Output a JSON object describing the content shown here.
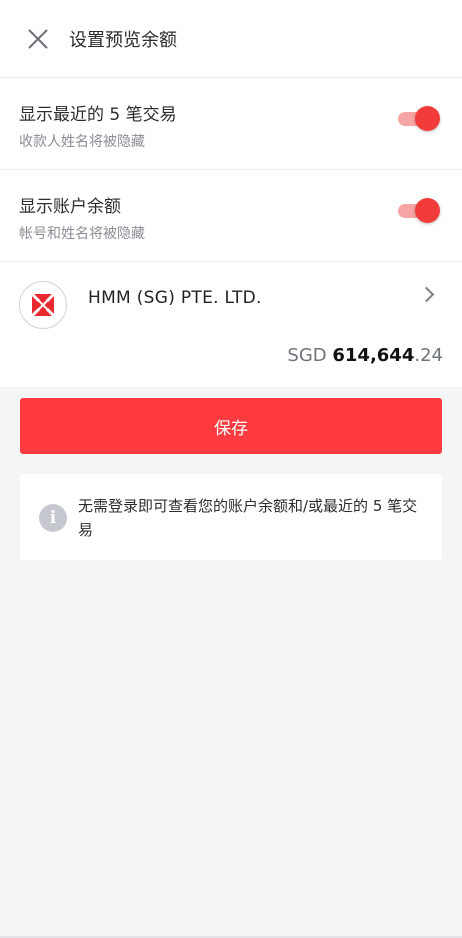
{
  "header": {
    "title": "设置预览余额",
    "close_icon": "close-icon"
  },
  "settings": [
    {
      "title": "显示最近的 5 笔交易",
      "subtitle": "收款人姓名将被隐藏",
      "toggle_on": true
    },
    {
      "title": "显示账户余额",
      "subtitle": "帐号和姓名将被隐藏",
      "toggle_on": true
    }
  ],
  "account": {
    "name": "HMM (SG) PTE. LTD.",
    "currency": "SGD",
    "balance_main": "614,644",
    "balance_decimal": ".24",
    "logo_icon": "bank-logo-icon",
    "chevron_icon": "chevron-right-icon"
  },
  "save_button": {
    "label": "保存"
  },
  "info": {
    "text": "无需登录即可查看您的账户余额和/或最近的 5 笔交易",
    "icon": "info-icon"
  },
  "colors": {
    "accent": "#ff3b3f",
    "toggle_knob": "#f23b3b",
    "toggle_track": "#f7a4a4",
    "background": "#f4f5f7"
  }
}
